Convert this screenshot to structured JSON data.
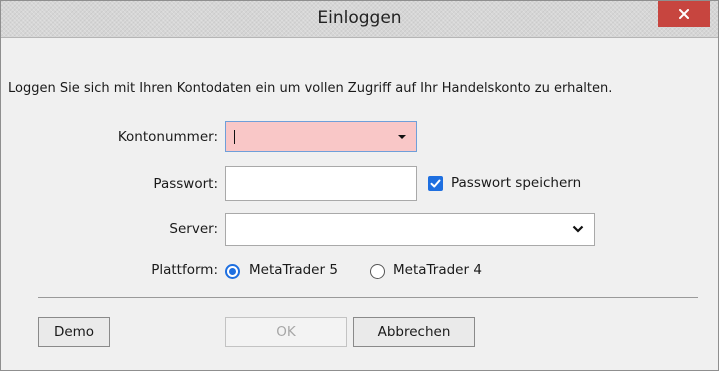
{
  "window": {
    "title": "Einloggen",
    "close_symbol": "×"
  },
  "info_text": "Loggen Sie sich mit Ihren Kontodaten ein um vollen Zugriff auf Ihr Handelskonto zu erhalten.",
  "form": {
    "kontonummer": {
      "label": "Kontonummer:",
      "value": "",
      "icon": "dropdown-arrow-icon"
    },
    "passwort": {
      "label": "Passwort:",
      "value": ""
    },
    "save_password": {
      "label": "Passwort speichern",
      "checked": true
    },
    "server": {
      "label": "Server:",
      "value": "",
      "icon": "chevron-down-icon"
    },
    "plattform": {
      "label": "Plattform:",
      "options": [
        {
          "label": "MetaTrader 5",
          "selected": true
        },
        {
          "label": "MetaTrader 4",
          "selected": false
        }
      ]
    }
  },
  "buttons": {
    "demo": "Demo",
    "ok": "OK",
    "cancel": "Abbrechen"
  },
  "colors": {
    "close_button": "#c7453f",
    "accent": "#1e6fe0",
    "invalid_field": "#f9c7c7"
  }
}
